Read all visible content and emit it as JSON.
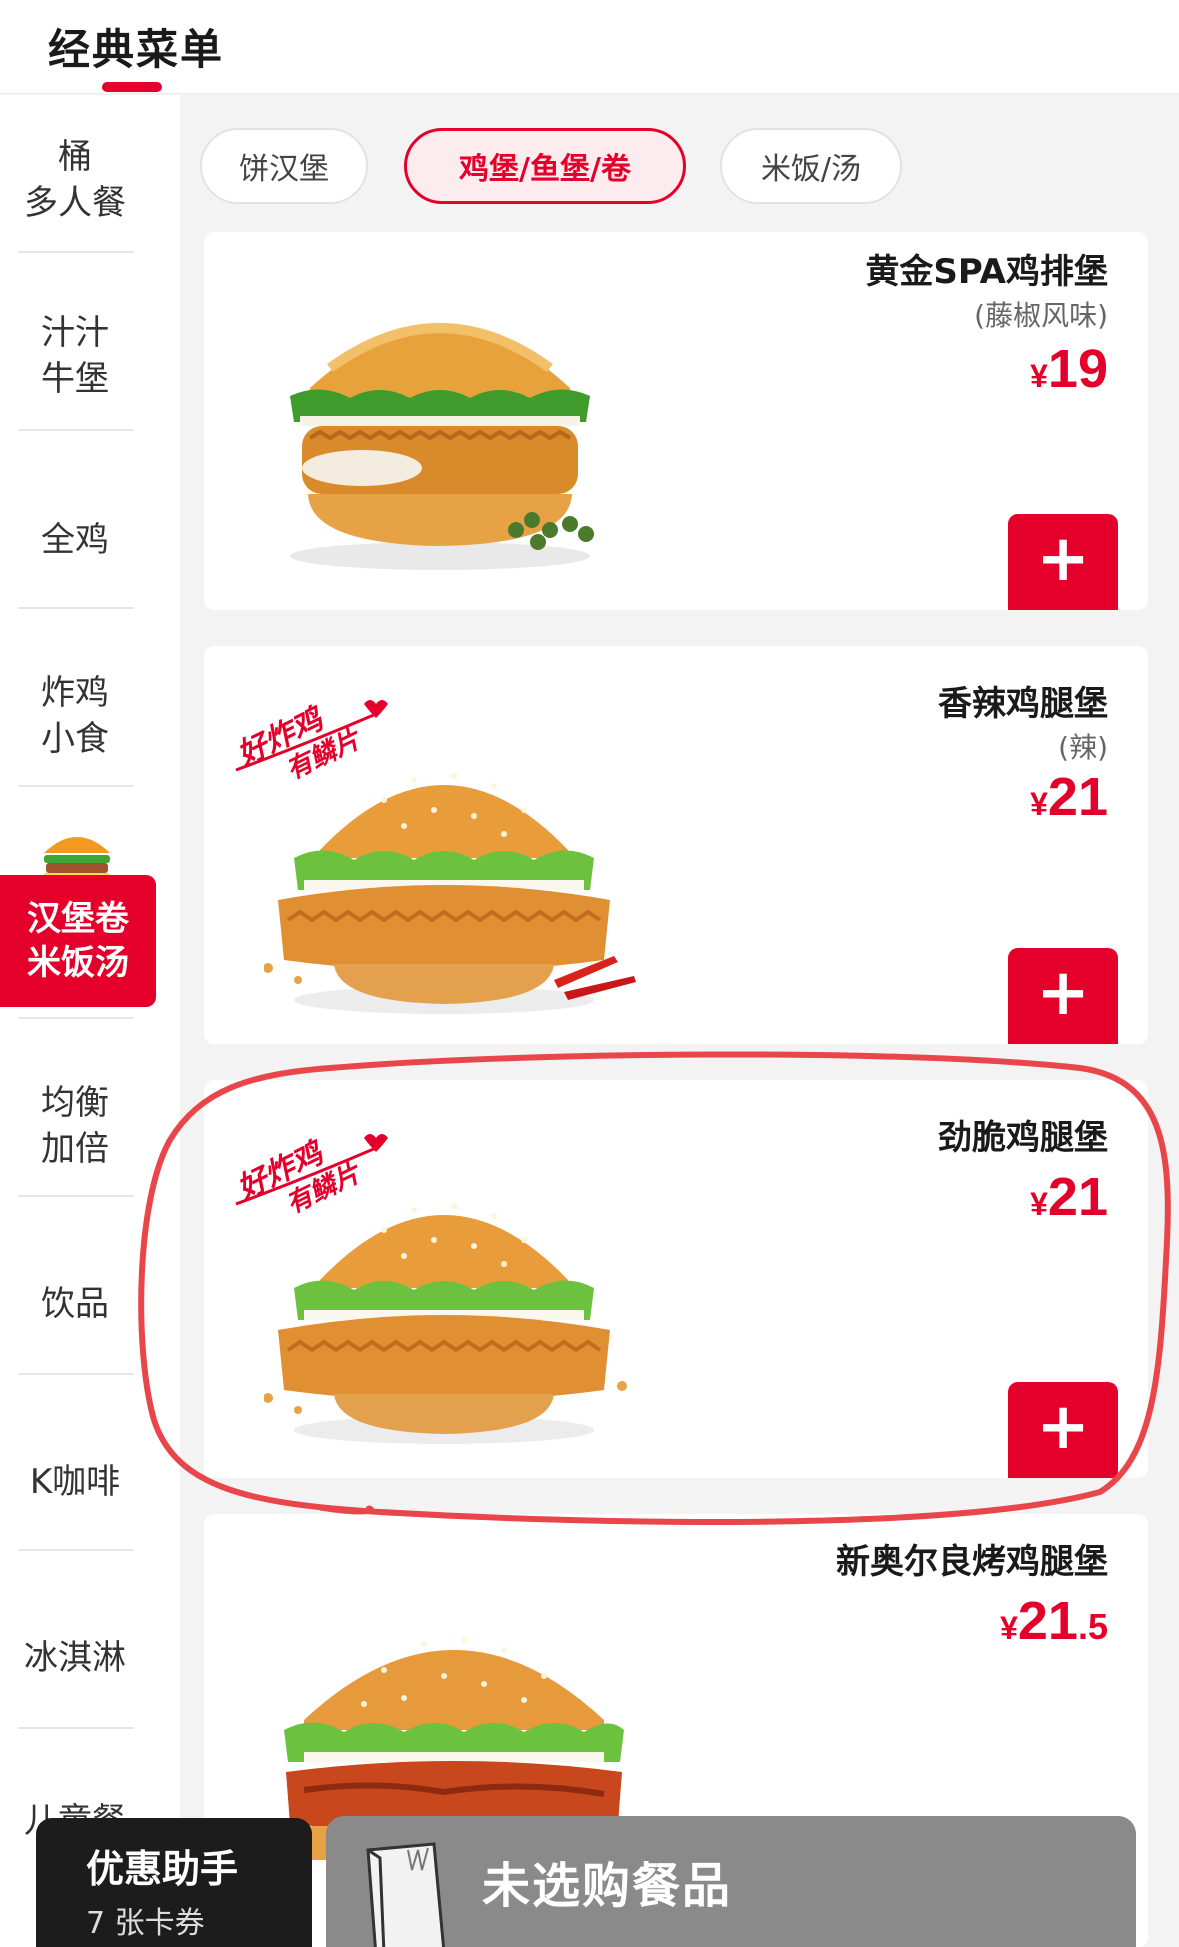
{
  "header": {
    "title": "经典菜单"
  },
  "sidebar": {
    "items": [
      {
        "lines": [
          "桶",
          "多人餐"
        ]
      },
      {
        "lines": [
          "汁汁",
          "牛堡"
        ]
      },
      {
        "lines": [
          "全鸡"
        ]
      },
      {
        "lines": [
          "炸鸡",
          "小食"
        ]
      },
      {
        "lines": [
          "汉堡卷",
          "米饭汤"
        ],
        "active": true,
        "icon": "burger-icon"
      },
      {
        "lines": [
          "均衡",
          "加倍"
        ]
      },
      {
        "lines": [
          "饮品"
        ]
      },
      {
        "lines": [
          "K咖啡"
        ]
      },
      {
        "lines": [
          "冰淇淋"
        ]
      },
      {
        "lines": [
          "儿童餐"
        ]
      }
    ]
  },
  "subtabs": [
    {
      "label": "饼汉堡",
      "active": false
    },
    {
      "label": "鸡堡/鱼堡/卷",
      "active": true
    },
    {
      "label": "米饭/汤",
      "active": false
    }
  ],
  "products": [
    {
      "name": "黄金SPA鸡排堡",
      "note": "(藤椒风味)",
      "currency": "¥",
      "price": "19",
      "price_decimal": "",
      "add_icon": "plus-icon"
    },
    {
      "name": "香辣鸡腿堡",
      "note": "(辣)",
      "currency": "¥",
      "price": "21",
      "price_decimal": "",
      "promo": "好炸鸡 有鳞片",
      "add_icon": "plus-icon"
    },
    {
      "name": "劲脆鸡腿堡",
      "note": "",
      "currency": "¥",
      "price": "21",
      "price_decimal": "",
      "promo": "好炸鸡 有鳞片",
      "add_icon": "plus-icon",
      "highlighted": true
    },
    {
      "name": "新奥尔良烤鸡腿堡",
      "note": "",
      "currency": "¥",
      "price": "21",
      "price_decimal": ".5"
    }
  ],
  "bottom": {
    "helper_title": "优惠助手",
    "helper_sub": "7 张卡券",
    "cart_text": "未选购餐品",
    "cart_icon": "shopping-bag-icon"
  },
  "colors": {
    "brand_red": "#e4002b",
    "highlight_red": "#e8464a",
    "cart_bar": "#8a8a8a"
  }
}
